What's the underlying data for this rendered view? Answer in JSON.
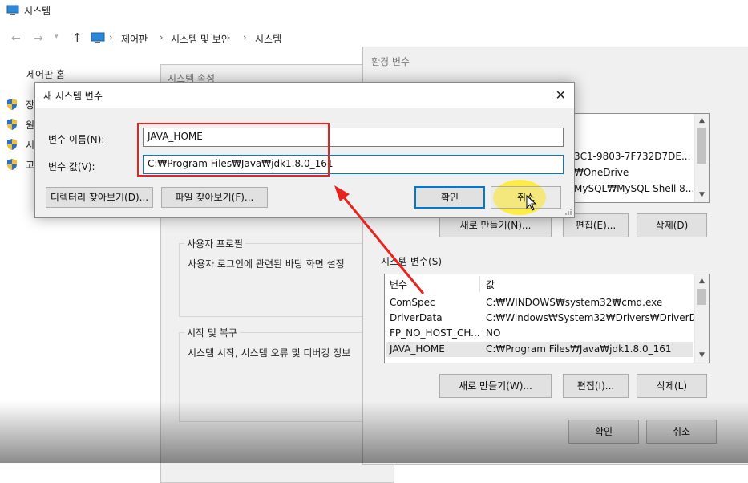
{
  "window": {
    "title": "시스템"
  },
  "breadcrumb": {
    "items": [
      "제어판",
      "시스템 및 보안",
      "시스템"
    ]
  },
  "sidebar": {
    "home": "제어판 홈",
    "items": [
      {
        "frag": "장",
        "icon": "shield-icon"
      },
      {
        "frag": "원",
        "icon": "shield-icon"
      },
      {
        "frag": "시",
        "icon": "shield-icon"
      },
      {
        "frag": "고",
        "icon": "shield-icon"
      }
    ]
  },
  "system_properties": {
    "title": "시스템 속성",
    "user_profile": {
      "legend": "사용자 프로필",
      "desc": "사용자 로그인에 관련된 바탕 화면 설정"
    },
    "startup_recovery": {
      "legend": "시작 및 복구",
      "desc": "시스템 시작, 시스템 오류 및 디버깅 정보"
    }
  },
  "env_vars": {
    "title": "환경 변수",
    "user_vars_partial": [
      "3C1-9803-7F732D7DE...",
      "₩OneDrive",
      "MySQL₩MySQL Shell 8...."
    ],
    "user_buttons": {
      "new": "새로 만들기(N)...",
      "edit": "편집(E)...",
      "delete": "삭제(D)"
    },
    "system_label": "시스템 변수(S)",
    "system_columns": {
      "name": "변수",
      "value": "값"
    },
    "system_rows": [
      {
        "name": "ComSpec",
        "value": "C:₩WINDOWS₩system32₩cmd.exe"
      },
      {
        "name": "DriverData",
        "value": "C:₩Windows₩System32₩Drivers₩DriverData"
      },
      {
        "name": "FP_NO_HOST_CH...",
        "value": "NO"
      },
      {
        "name": "JAVA_HOME",
        "value": "C:₩Program Files₩Java₩jdk1.8.0_161"
      }
    ],
    "system_buttons": {
      "new": "새로 만들기(W)...",
      "edit": "편집(I)...",
      "delete": "삭제(L)"
    },
    "ok": "확인",
    "cancel": "취소"
  },
  "dialog": {
    "title": "새 시스템 변수",
    "name_label": "변수 이름(N):",
    "name_value": "JAVA_HOME",
    "value_label": "변수 값(V):",
    "value_value": "C:₩Program Files₩Java₩jdk1.8.0_161",
    "browse_dir": "디렉터리 찾아보기(D)...",
    "browse_file": "파일 찾아보기(F)...",
    "ok": "확인",
    "cancel": "취소"
  },
  "colors": {
    "annotation_red": "#e8231d",
    "cursor_highlight": "#ffeb28",
    "focus_blue": "#0078d7"
  }
}
